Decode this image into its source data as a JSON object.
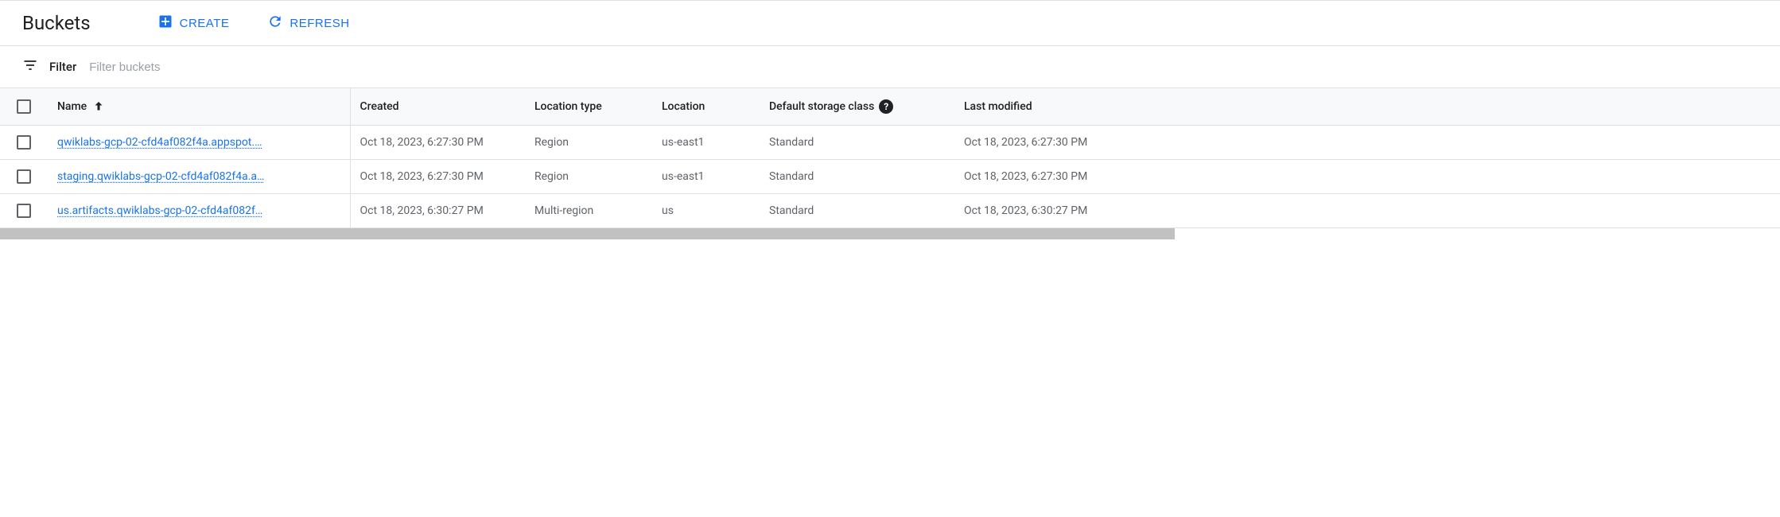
{
  "header": {
    "title": "Buckets",
    "create_label": "CREATE",
    "refresh_label": "REFRESH"
  },
  "filter": {
    "label": "Filter",
    "placeholder": "Filter buckets"
  },
  "columns": {
    "name": "Name",
    "created": "Created",
    "location_type": "Location type",
    "location": "Location",
    "default_storage_class": "Default storage class",
    "last_modified": "Last modified"
  },
  "rows": [
    {
      "name": "qwiklabs-gcp-02-cfd4af082f4a.appspot.…",
      "created": "Oct 18, 2023, 6:27:30 PM",
      "location_type": "Region",
      "location": "us-east1",
      "storage_class": "Standard",
      "last_modified": "Oct 18, 2023, 6:27:30 PM"
    },
    {
      "name": "staging.qwiklabs-gcp-02-cfd4af082f4a.a…",
      "created": "Oct 18, 2023, 6:27:30 PM",
      "location_type": "Region",
      "location": "us-east1",
      "storage_class": "Standard",
      "last_modified": "Oct 18, 2023, 6:27:30 PM"
    },
    {
      "name": "us.artifacts.qwiklabs-gcp-02-cfd4af082f…",
      "created": "Oct 18, 2023, 6:30:27 PM",
      "location_type": "Multi-region",
      "location": "us",
      "storage_class": "Standard",
      "last_modified": "Oct 18, 2023, 6:30:27 PM"
    }
  ],
  "help_glyph": "?"
}
